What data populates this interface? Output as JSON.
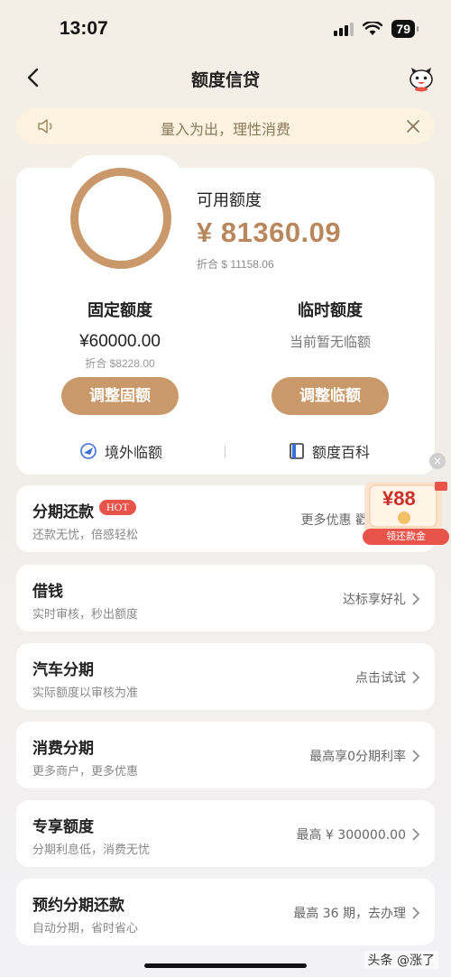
{
  "status_bar": {
    "time": "13:07",
    "battery": "79"
  },
  "nav": {
    "title": "额度信贷"
  },
  "notice": {
    "text": "量入为出，理性消费"
  },
  "credit": {
    "available_label": "可用额度",
    "available_amount": "¥ 81360.09",
    "available_sub": "折合 $ 11158.06",
    "fixed": {
      "title": "固定额度",
      "value": "¥60000.00",
      "sub": "折合 $8228.00",
      "button": "调整固额"
    },
    "temp": {
      "title": "临时额度",
      "value": "当前暂无临额",
      "sub": "",
      "button": "调整临额"
    },
    "links": {
      "overseas": "境外临额",
      "encyclopedia": "额度百科"
    }
  },
  "list": [
    {
      "title": "分期还款",
      "badge": "HOT",
      "sub": "还款无忧，倍感轻松",
      "right": "更多优惠 戳"
    },
    {
      "title": "借钱",
      "sub": "实时审核，秒出额度",
      "right": "达标享好礼"
    },
    {
      "title": "汽车分期",
      "sub": "实际额度以审核为准",
      "right": "点击试试"
    },
    {
      "title": "消费分期",
      "sub": "更多商户，更多优惠",
      "right": "最高享0分期利率"
    },
    {
      "title": "专享额度",
      "sub": "分期利息低，消费无忧",
      "right": "最高 ¥ 300000.00"
    },
    {
      "title": "预约分期还款",
      "sub": "自动分期，省时省心",
      "right": "最高 36 期，去办理"
    }
  ],
  "promo": {
    "amount": "¥88",
    "button": "领还款金"
  },
  "watermark": "头条 @涨了",
  "colors": {
    "accent": "#c9996b",
    "amount": "#b8875b",
    "hot": "#e8534a"
  }
}
